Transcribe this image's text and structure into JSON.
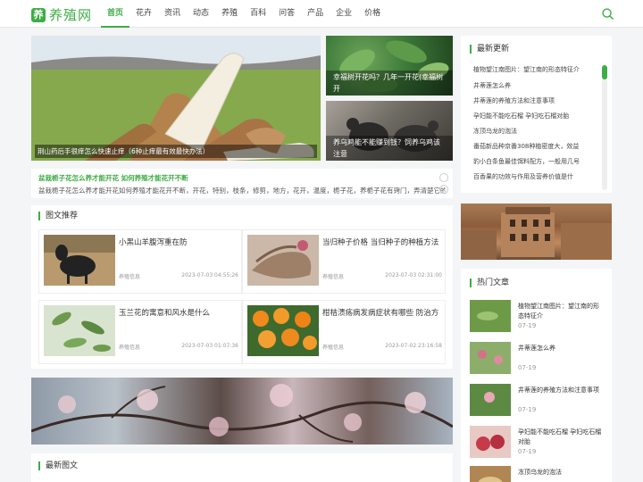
{
  "header": {
    "logo_badge": "养",
    "logo_text": "养殖网",
    "nav": [
      "首页",
      "花卉",
      "资讯",
      "动态",
      "养殖",
      "百科",
      "问答",
      "产品",
      "企业",
      "价格"
    ],
    "active_index": 0,
    "accent": "#3fad46"
  },
  "hero": {
    "main_caption": "荆山药后手很痒怎么快速止痒（6种止痒最有效最快办法）",
    "side": [
      {
        "caption": "幸福树开花吗？几年一开花(幸福树开"
      },
      {
        "caption": "养乌鸡能不能赚到钱？饲养乌鸡该注意"
      }
    ]
  },
  "notice": {
    "title": "盆栽栀子花怎么养才能开花 如何养殖才能花开不断",
    "text": "盆栽栀子花怎么养才能开花如何养殖才能花开不断，开花，特别，枝条，修剪，地方，花开，温度，栀子花，养栀子花有窍门，弄清楚它的生活习性"
  },
  "picks": {
    "title": "图文推荐",
    "cards": [
      {
        "title": "小黑山羊腹泻重在防",
        "source": "养殖信息",
        "time": "2023-07-03 04:55:26"
      },
      {
        "title": "当归种子价格 当归种子的种植方法",
        "source": "养殖信息",
        "time": "2023-07-03 02:31:00"
      },
      {
        "title": "玉兰花的寓意和风水是什么",
        "source": "养殖信息",
        "time": "2023-07-03 01:07:36"
      },
      {
        "title": "柑桔溃疡病发病症状有哪些 防治方",
        "source": "养殖信息",
        "time": "2023-07-02 23:16:58"
      }
    ]
  },
  "latest_graphic": {
    "title": "最新图文"
  },
  "latest_updates": {
    "title": "最新更新",
    "items": [
      "植物望江南图片：望江南的形态特征介",
      "井蒂莲怎么养",
      "井蒂莲的养殖方法和注意事项",
      "孕妇能不能吃石榴 孕妇吃石榴对胎",
      "冻顶乌龙的泡法",
      "番茄新品种京番308种植密度大，效益",
      "豹小白条鱼最佳饵料配方，一般用几号",
      "百香果的功效与作用及营养价值是什"
    ]
  },
  "hot": {
    "title": "热门文章",
    "items": [
      {
        "title": "植物望江南图片：望江南的形态特征介",
        "date": "07-19"
      },
      {
        "title": "井蒂莲怎么养",
        "date": "07-19"
      },
      {
        "title": "井蒂莲的养殖方法和注意事项",
        "date": "07-19"
      },
      {
        "title": "孕妇能不能吃石榴 孕妇吃石榴对胎",
        "date": "07-19"
      },
      {
        "title": "冻顶乌龙的泡法",
        "date": ""
      }
    ]
  }
}
